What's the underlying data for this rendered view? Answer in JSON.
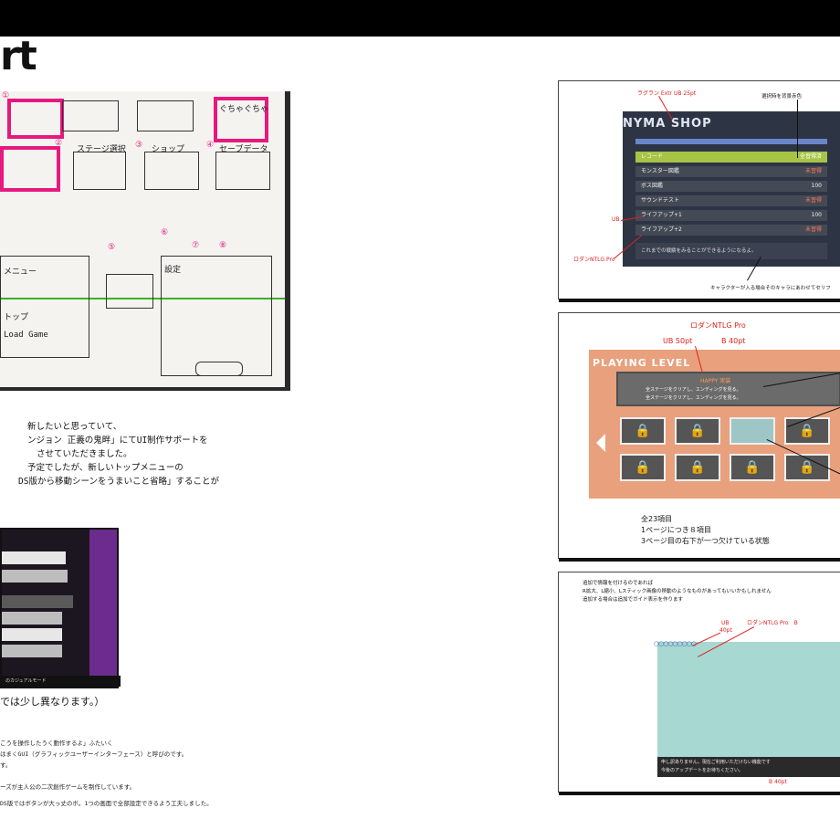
{
  "page": {
    "title_fragment": "rt"
  },
  "sketch": {
    "magenta_numbers": [
      "①",
      "②",
      "③",
      "④",
      "⑤",
      "⑥",
      "⑦",
      "⑧"
    ],
    "scribbles": [
      "ぐちゃぐちゃ",
      "ステージ選択",
      "ショップ",
      "セーブデータ",
      "設定",
      "メニュー",
      "トップ",
      "Load Game"
    ]
  },
  "paragraph": {
    "lines": [
      "新したいと思っていて、",
      "ンジョン 正義の鬼畔」にてUI制作サポートを",
      "させていただきました。",
      "予定でしたが、新しいトップメニューの",
      "DS版から移動シーンをうまいこと省略」することが"
    ]
  },
  "menu_shot": {
    "caption": "のカジュアルモード",
    "note": "では少し異なります。）"
  },
  "notes": {
    "lines": [
      "こうを操作したうく動作するよ」ふたいく",
      "はまくGUI（グラフィックユーザーインターフェース）と呼びのです。",
      "す。",
      "ーズが主人公の二次創作ゲームを制作しています。",
      "DS版ではボタンが大っ丈のボ。1つの画面で全部設定できるよう工夫しました。"
    ]
  },
  "panel1": {
    "header": "NYMA SHOP",
    "label_top": "ラグラン Extr UB 25pt",
    "label_right": "選択時を背景赤色",
    "items": [
      {
        "label": "レコード",
        "value": "全習得済"
      },
      {
        "label": "モンスター図鑑",
        "value": "未習得"
      },
      {
        "label": "ボス図鑑",
        "value": "100"
      },
      {
        "label": "サウンドテスト",
        "value": "未習得"
      },
      {
        "label": "ライフアップ+1",
        "value": "100"
      },
      {
        "label": "ライフアップ+2",
        "value": "未習得"
      }
    ],
    "description": "これまでの戦績をみることができるようになるよ。",
    "label_ub": "UB",
    "label_font": "ロダンNTLG Pro",
    "label_bottom": "キャラクターが入る場合そのキャラにあわせてセリフ"
  },
  "panel2": {
    "font_label": "ロダンNTLG Pro",
    "ub_label": "UB 50pt",
    "b_label": "B 40pt",
    "header": "PLAYING LEVEL",
    "box_title": "HAPPY 実装",
    "box_line1": "全ステージをクリアし、エンディングを見る。",
    "box_line2": "全ステージをクリアし、エンディングを見る。",
    "count_lines": [
      "全23項目",
      "1ページにつき８項目",
      "3ページ目の右下が一つ欠けている状態"
    ]
  },
  "panel3": {
    "text_lines": [
      "追加で情報を付けるのであれば",
      "R拡大、L縮小、Lスティック画像の移動のようなものがあってもいいかもしれません",
      "追加する場合は追加でガイド表示を作ります"
    ],
    "label_ub": "UB",
    "label_ub_size": "40pt",
    "label_font": "ロダンNTLG Pro　B",
    "label_40": "40pt",
    "bottom_text_1": "申し訳ありません。現在ご利用いただけない機能です",
    "bottom_text_2": "今後のアップデートをお待ちください。",
    "label_b40": "B 40pt"
  }
}
